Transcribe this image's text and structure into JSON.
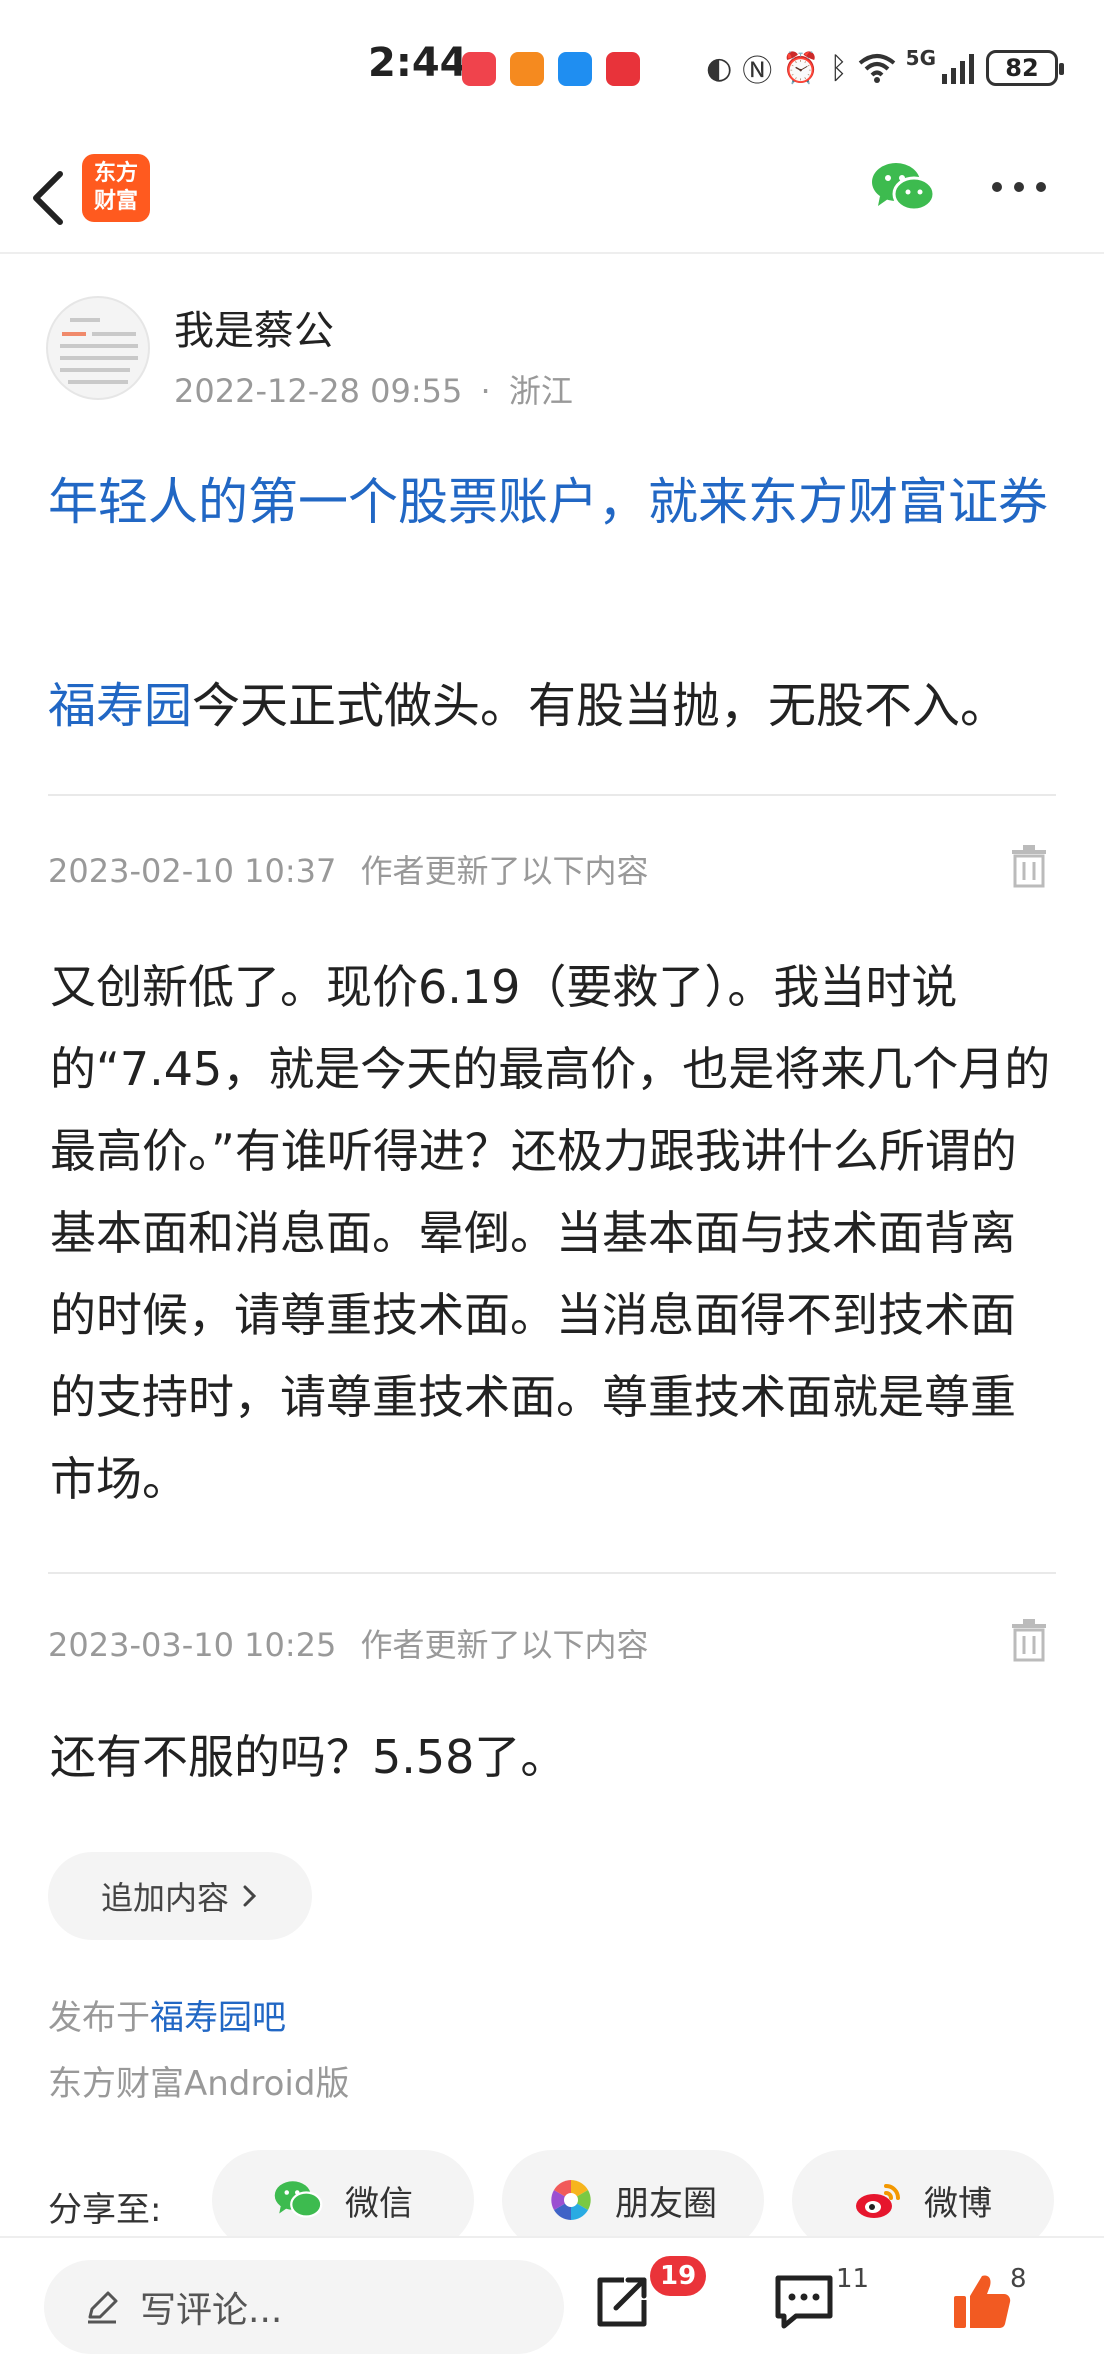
{
  "status_bar": {
    "time": "2:44",
    "network": "5G",
    "battery": "82",
    "app_icon_colors": [
      "#f0434c",
      "#f58a1f",
      "#1f8ef1",
      "#e8333a"
    ]
  },
  "nav": {
    "logo_text": "东方财富",
    "logo_line1": "东方",
    "logo_line2": "财富",
    "accent_color": "#ff5a1f"
  },
  "author": {
    "name": "我是蔡公",
    "datetime": "2022-12-28 09:55",
    "location": "浙江",
    "separator": "·"
  },
  "post": {
    "title": "年轻人的第一个股票账户，就来东方财富证券",
    "stock_link": "福寿园",
    "body": "今天正式做头。有股当抛，无股不入。"
  },
  "updates": [
    {
      "timestamp": "2023-02-10 10:37",
      "note": "作者更新了以下内容",
      "text": "又创新低了。现价6.19（要救了）。我当时说的“7.45，就是今天的最高价，也是将来几个月的最高价。”有谁听得进？还极力跟我讲什么所谓的基本面和消息面。晕倒。当基本面与技术面背离的时候，请尊重技术面。当消息面得不到技术面的支持时，请尊重技术面。尊重技术面就是尊重市场。"
    },
    {
      "timestamp": "2023-03-10 10:25",
      "note": "作者更新了以下内容",
      "text": "还有不服的吗？5.58了。"
    }
  ],
  "add_content_label": "追加内容",
  "posted_in": {
    "prefix": "发布于",
    "forum": "福寿园吧"
  },
  "platform": "东方财富Android版",
  "share": {
    "label": "分享至:",
    "wechat": "微信",
    "moments": "朋友圈",
    "weibo": "微博"
  },
  "bottom_bar": {
    "comment_placeholder": "写评论...",
    "share_count": "19",
    "comment_count": "11",
    "like_count": "8"
  }
}
